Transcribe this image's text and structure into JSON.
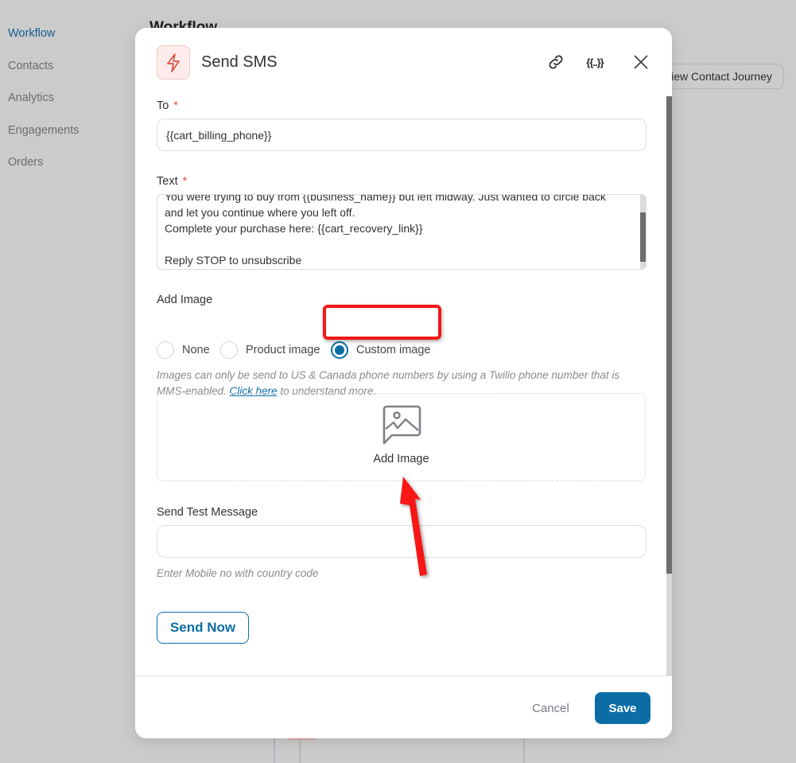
{
  "sidebar": {
    "items": [
      {
        "label": "Workflow",
        "active": true
      },
      {
        "label": "Contacts",
        "active": false
      },
      {
        "label": "Analytics",
        "active": false
      },
      {
        "label": "Engagements",
        "active": false
      },
      {
        "label": "Orders",
        "active": false
      }
    ]
  },
  "background": {
    "heading": "Workflow",
    "journey_button": "View Contact Journey"
  },
  "modal": {
    "title": "Send SMS",
    "header_icon": "lightning-bolt-icon",
    "header_actions": {
      "link_icon": "link-icon",
      "variables_label": "{{..}}",
      "close_icon": "close-icon"
    },
    "to": {
      "label": "To",
      "required_mark": "*",
      "value": "{{cart_billing_phone}}"
    },
    "text": {
      "label": "Text",
      "required_mark": "*",
      "value": "You were trying to buy from {{business_name}} but left midway. Just wanted to circle back\nand let you continue where you left off.\nComplete your purchase here: {{cart_recovery_link}}\n\nReply STOP to unsubscribe"
    },
    "add_image": {
      "label": "Add Image",
      "options": [
        {
          "label": "None",
          "checked": false
        },
        {
          "label": "Product image",
          "checked": false
        },
        {
          "label": "Custom image",
          "checked": true
        }
      ],
      "hint_before": "Images can only be send to US & Canada phone numbers by using a Twilio phone number that is MMS-enabled. ",
      "hint_link": "Click here",
      "hint_after": " to understand more.",
      "dropzone_label": "Add Image",
      "dropzone_icon": "image-icon"
    },
    "test_message": {
      "label": "Send Test Message",
      "value": "",
      "placeholder": "",
      "hint": "Enter Mobile no with country code",
      "send_button": "Send Now"
    },
    "footer": {
      "cancel": "Cancel",
      "save": "Save"
    }
  },
  "colors": {
    "accent": "#0c6da5",
    "required": "#e0523f",
    "annotation": "#f01818"
  }
}
